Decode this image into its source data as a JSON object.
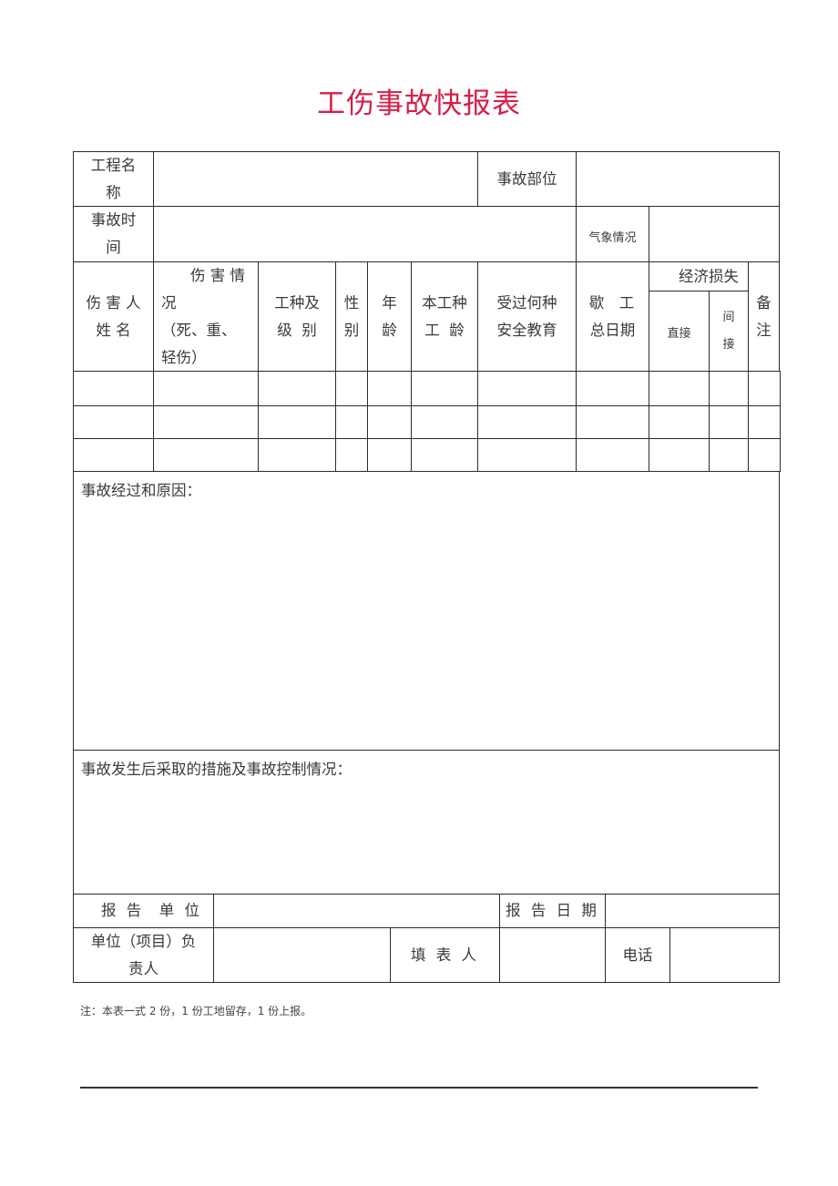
{
  "title": "工伤事故快报表",
  "title_color": "#d81e48",
  "form": {
    "project_name_label": [
      "工程名",
      "称"
    ],
    "project_name_value": "",
    "accident_location_label": "事故部位",
    "accident_location_value": "",
    "accident_time_label": [
      "事故时",
      "间"
    ],
    "accident_time_value": "",
    "weather_label": "气象情况",
    "weather_value": "",
    "columns": {
      "injured_name": [
        "伤 害 人",
        "姓 名"
      ],
      "injury_status": [
        "伤 害 情",
        "况",
        "（死、重、",
        "轻伤）"
      ],
      "job_grade": [
        "工种及",
        "级  别"
      ],
      "gender": [
        "性",
        "别"
      ],
      "age": [
        "年",
        "龄"
      ],
      "job_seniority": [
        "本工种",
        "工  龄"
      ],
      "safety_education": [
        "受过何种",
        "安全教育"
      ],
      "lost_workdays": [
        "歇  工",
        "总日期"
      ],
      "economic_loss": "经济损失",
      "direct": "直接",
      "indirect": [
        "间",
        "接"
      ],
      "remarks": [
        "备",
        "注"
      ]
    },
    "rows": [
      [
        "",
        "",
        "",
        "",
        "",
        "",
        "",
        "",
        "",
        "",
        ""
      ],
      [
        "",
        "",
        "",
        "",
        "",
        "",
        "",
        "",
        "",
        "",
        ""
      ],
      [
        "",
        "",
        "",
        "",
        "",
        "",
        "",
        "",
        "",
        "",
        ""
      ]
    ],
    "process_cause_label": "事故经过和原因：",
    "process_cause_value": "",
    "measures_label": "事故发生后采取的措施及事故控制情况：",
    "measures_value": "",
    "reporting_unit_label": "报 告  单 位",
    "reporting_unit_value": "",
    "report_date_label": "报 告 日 期",
    "report_date_value": "",
    "responsible_label": [
      "单位（项目）负",
      "责人"
    ],
    "responsible_value": "",
    "filler_label": "填 表 人",
    "filler_value": "",
    "phone_label": "电话",
    "phone_value": ""
  },
  "note": "注：本表一式 2 份，1 份工地留存，1 份上报。"
}
